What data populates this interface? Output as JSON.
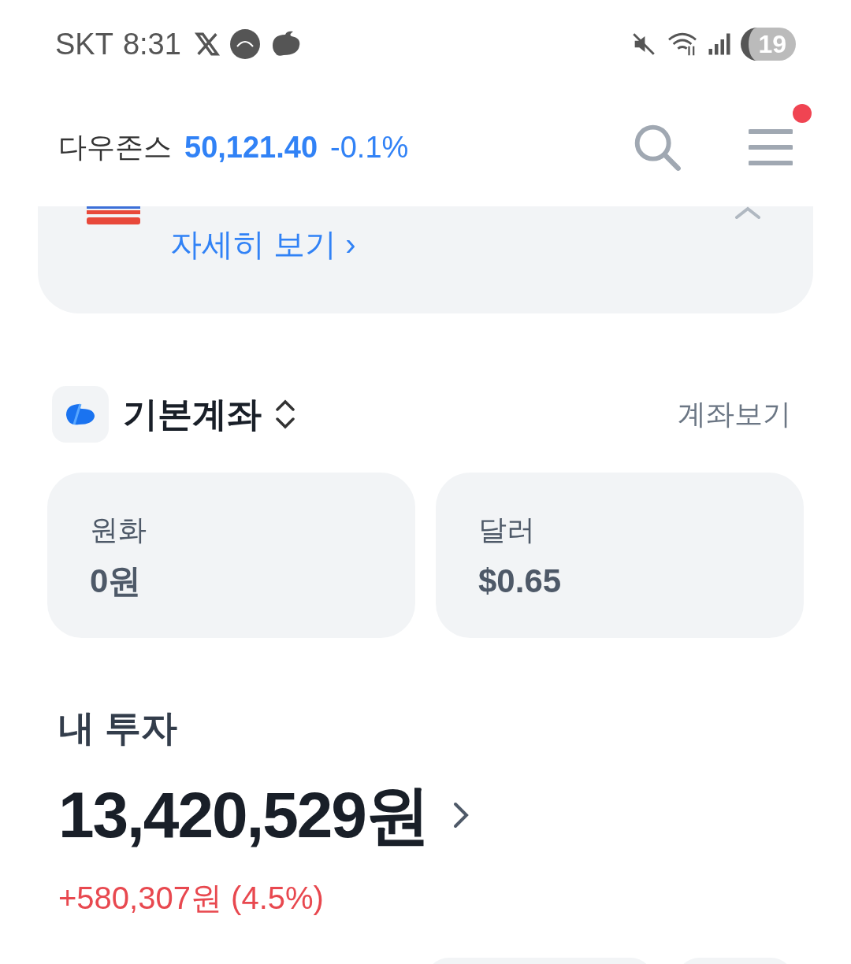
{
  "status_bar": {
    "carrier": "SKT",
    "time": "8:31",
    "battery": "19"
  },
  "header": {
    "index_name": "다우존스",
    "index_value": "50,121.40",
    "index_change": "-0.1%",
    "menu_badge": true
  },
  "banner": {
    "link": "자세히 보기 ›",
    "expanded": true
  },
  "account": {
    "name": "기본계좌",
    "link": "계좌보기"
  },
  "balances": [
    {
      "label": "원화",
      "value": "0원"
    },
    {
      "label": "달러",
      "value": "$0.65"
    }
  ],
  "investment": {
    "title": "내 투자",
    "total": "13,420,529원",
    "change": "+580,307원 (4.5%)"
  }
}
